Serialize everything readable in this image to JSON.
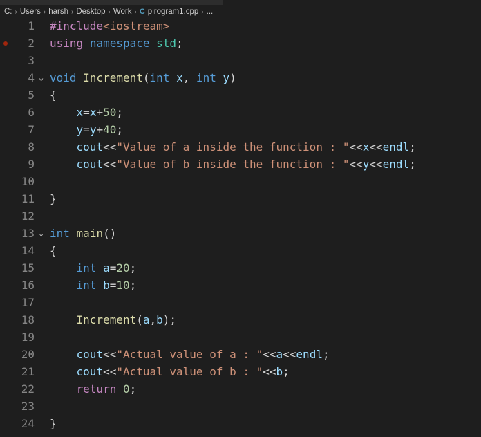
{
  "breadcrumb": {
    "items": [
      "C:",
      "Users",
      "harsh",
      "Desktop",
      "Work"
    ],
    "file_icon": "C",
    "file": "pirogram1.cpp",
    "more": "..."
  },
  "editor": {
    "language": "cpp",
    "breakpoint_line": 2,
    "folded_markers": [
      4,
      13
    ],
    "lines": [
      {
        "n": "1",
        "segments": [
          [
            "ctl",
            "#include"
          ],
          [
            "str",
            "<iostream>"
          ]
        ]
      },
      {
        "n": "2",
        "segments": [
          [
            "ctl",
            "using"
          ],
          [
            "op",
            " "
          ],
          [
            "kw",
            "namespace"
          ],
          [
            "op",
            " "
          ],
          [
            "typ",
            "std"
          ],
          [
            "op",
            ";"
          ]
        ]
      },
      {
        "n": "3",
        "segments": []
      },
      {
        "n": "4",
        "segments": [
          [
            "kw",
            "void"
          ],
          [
            "op",
            " "
          ],
          [
            "fn",
            "Increment"
          ],
          [
            "op",
            "("
          ],
          [
            "kw",
            "int"
          ],
          [
            "op",
            " "
          ],
          [
            "var",
            "x"
          ],
          [
            "op",
            ", "
          ],
          [
            "kw",
            "int"
          ],
          [
            "op",
            " "
          ],
          [
            "var",
            "y"
          ],
          [
            "op",
            ")"
          ]
        ]
      },
      {
        "n": "5",
        "segments": [
          [
            "op",
            "{"
          ]
        ]
      },
      {
        "n": "6",
        "segments": [
          [
            "op",
            "    "
          ],
          [
            "var",
            "x"
          ],
          [
            "op",
            "="
          ],
          [
            "var",
            "x"
          ],
          [
            "op",
            "+"
          ],
          [
            "num",
            "50"
          ],
          [
            "op",
            ";"
          ]
        ]
      },
      {
        "n": "7",
        "segments": [
          [
            "op",
            "    "
          ],
          [
            "var",
            "y"
          ],
          [
            "op",
            "="
          ],
          [
            "var",
            "y"
          ],
          [
            "op",
            "+"
          ],
          [
            "num",
            "40"
          ],
          [
            "op",
            ";"
          ]
        ]
      },
      {
        "n": "8",
        "segments": [
          [
            "op",
            "    "
          ],
          [
            "var",
            "cout"
          ],
          [
            "op",
            "<<"
          ],
          [
            "str",
            "\"Value of a inside the function : \""
          ],
          [
            "op",
            "<<"
          ],
          [
            "var",
            "x"
          ],
          [
            "op",
            "<<"
          ],
          [
            "var",
            "endl"
          ],
          [
            "op",
            ";"
          ]
        ]
      },
      {
        "n": "9",
        "segments": [
          [
            "op",
            "    "
          ],
          [
            "var",
            "cout"
          ],
          [
            "op",
            "<<"
          ],
          [
            "str",
            "\"Value of b inside the function : \""
          ],
          [
            "op",
            "<<"
          ],
          [
            "var",
            "y"
          ],
          [
            "op",
            "<<"
          ],
          [
            "var",
            "endl"
          ],
          [
            "op",
            ";"
          ]
        ]
      },
      {
        "n": "10",
        "segments": []
      },
      {
        "n": "11",
        "segments": [
          [
            "op",
            "}"
          ]
        ]
      },
      {
        "n": "12",
        "segments": []
      },
      {
        "n": "13",
        "segments": [
          [
            "kw",
            "int"
          ],
          [
            "op",
            " "
          ],
          [
            "fn",
            "main"
          ],
          [
            "op",
            "()"
          ]
        ]
      },
      {
        "n": "14",
        "segments": [
          [
            "op",
            "{"
          ]
        ]
      },
      {
        "n": "15",
        "segments": [
          [
            "op",
            "    "
          ],
          [
            "kw",
            "int"
          ],
          [
            "op",
            " "
          ],
          [
            "var",
            "a"
          ],
          [
            "op",
            "="
          ],
          [
            "num",
            "20"
          ],
          [
            "op",
            ";"
          ]
        ]
      },
      {
        "n": "16",
        "segments": [
          [
            "op",
            "    "
          ],
          [
            "kw",
            "int"
          ],
          [
            "op",
            " "
          ],
          [
            "var",
            "b"
          ],
          [
            "op",
            "="
          ],
          [
            "num",
            "10"
          ],
          [
            "op",
            ";"
          ]
        ]
      },
      {
        "n": "17",
        "segments": []
      },
      {
        "n": "18",
        "segments": [
          [
            "op",
            "    "
          ],
          [
            "fn",
            "Increment"
          ],
          [
            "op",
            "("
          ],
          [
            "var",
            "a"
          ],
          [
            "op",
            ","
          ],
          [
            "var",
            "b"
          ],
          [
            "op",
            ");"
          ]
        ]
      },
      {
        "n": "19",
        "segments": []
      },
      {
        "n": "20",
        "segments": [
          [
            "op",
            "    "
          ],
          [
            "var",
            "cout"
          ],
          [
            "op",
            "<<"
          ],
          [
            "str",
            "\"Actual value of a : \""
          ],
          [
            "op",
            "<<"
          ],
          [
            "var",
            "a"
          ],
          [
            "op",
            "<<"
          ],
          [
            "var",
            "endl"
          ],
          [
            "op",
            ";"
          ]
        ]
      },
      {
        "n": "21",
        "segments": [
          [
            "op",
            "    "
          ],
          [
            "var",
            "cout"
          ],
          [
            "op",
            "<<"
          ],
          [
            "str",
            "\"Actual value of b : \""
          ],
          [
            "op",
            "<<"
          ],
          [
            "var",
            "b"
          ],
          [
            "op",
            ";"
          ]
        ]
      },
      {
        "n": "22",
        "segments": [
          [
            "op",
            "    "
          ],
          [
            "ctl",
            "return"
          ],
          [
            "op",
            " "
          ],
          [
            "num",
            "0"
          ],
          [
            "op",
            ";"
          ]
        ]
      },
      {
        "n": "23",
        "segments": []
      },
      {
        "n": "24",
        "segments": [
          [
            "op",
            "}"
          ]
        ]
      }
    ]
  },
  "colors": {
    "background": "#1e1e1e",
    "line_number": "#858585",
    "keyword": "#569cd6",
    "control": "#c586c0",
    "function": "#dcdcaa",
    "variable": "#9cdcfe",
    "number": "#b5cea8",
    "string": "#ce9178",
    "type": "#4ec9b0",
    "breakpoint": "#a1260d"
  }
}
